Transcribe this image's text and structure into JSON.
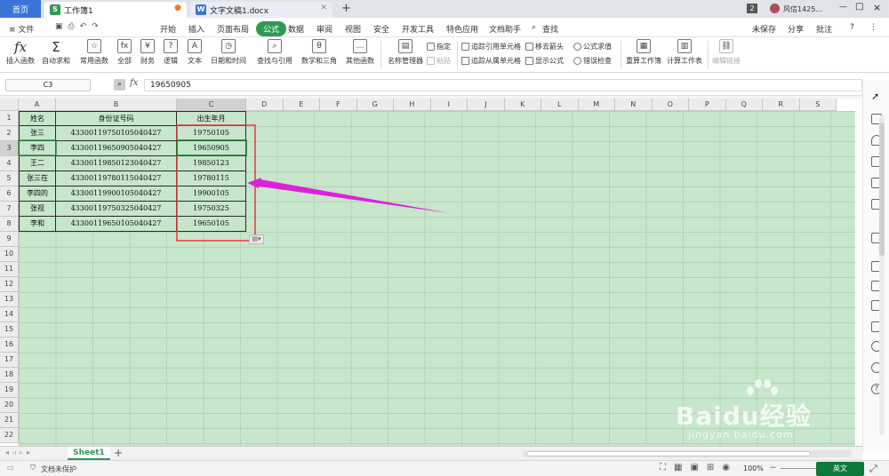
{
  "tabs": {
    "home": "首页",
    "workbook": "工作簿1",
    "document": "文字文稿1.docx",
    "add": "+"
  },
  "titlebar_right": {
    "count": "2",
    "user": "风信1425...",
    "min": "—",
    "max": "□",
    "close": "×"
  },
  "menu": {
    "file": "≡ 文件",
    "items": [
      "开始",
      "插入",
      "页面布局",
      "公式",
      "数据",
      "审阅",
      "视图",
      "安全",
      "开发工具",
      "特色应用",
      "文档助手",
      "查找"
    ],
    "right": [
      "未保存",
      "分享",
      "批注",
      "?",
      "⋮"
    ]
  },
  "ribbon": {
    "insert_fn": "插入函数",
    "autosum": "自动求和",
    "common": "常用函数",
    "all": "全部",
    "finance": "财务",
    "logic": "逻辑",
    "text": "文本",
    "datetime": "日期和时间",
    "lookup": "查找与引用",
    "math": "数学和三角",
    "other": "其他函数",
    "name_mgr": "名称管理器",
    "assign": "指定",
    "paste": "粘贴",
    "trace_prec": "追踪引用单元格",
    "trace_dep": "追踪从属单元格",
    "remove_arrow": "移去箭头",
    "show_formula": "显示公式",
    "eval": "公式求值",
    "error_check": "错误检查",
    "recalc": "重算工作簿",
    "calc_sheet": "计算工作表",
    "edit_links": "编辑链接"
  },
  "formula_bar": {
    "cell_ref": "C3",
    "fx": "fx",
    "value": "19650905"
  },
  "columns": [
    "A",
    "B",
    "C",
    "D",
    "E",
    "F",
    "G",
    "H",
    "I",
    "J",
    "K",
    "L",
    "M",
    "N",
    "O",
    "P",
    "Q",
    "R",
    "S"
  ],
  "rows": [
    "1",
    "2",
    "3",
    "4",
    "5",
    "6",
    "7",
    "8",
    "9",
    "10",
    "11",
    "12",
    "13",
    "14",
    "15",
    "16",
    "17",
    "18",
    "19",
    "20",
    "21",
    "22"
  ],
  "table": {
    "headers": [
      "姓名",
      "身份证号码",
      "出生年月"
    ],
    "data": [
      [
        "张三",
        "433001197501050404​27",
        "19750105"
      ],
      [
        "李四",
        "433001196509050404​27",
        "19650905"
      ],
      [
        "王二",
        "433001198501230404​27",
        "19850123"
      ],
      [
        "张三在",
        "433001197801150404​27",
        "19780115"
      ],
      [
        "李四的",
        "433001199001050404​27",
        "19900105"
      ],
      [
        "张视",
        "433001197503250404​27",
        "19750325"
      ],
      [
        "李和",
        "433001196501050404​27",
        "19650105"
      ]
    ]
  },
  "sheet": {
    "name": "Sheet1",
    "add": "+"
  },
  "status": {
    "protect": "文档未保护",
    "zoom": "100%",
    "ime": "英文"
  },
  "watermark": {
    "brand": "Baidu经验",
    "url": "jingyan.baidu.com"
  },
  "colors": {
    "accent": "#2e9a56",
    "grid_bg": "#c7e6cb",
    "highlight": "#e8393f",
    "arrow": "#e020d8",
    "tab_blue": "#3b74d8"
  }
}
